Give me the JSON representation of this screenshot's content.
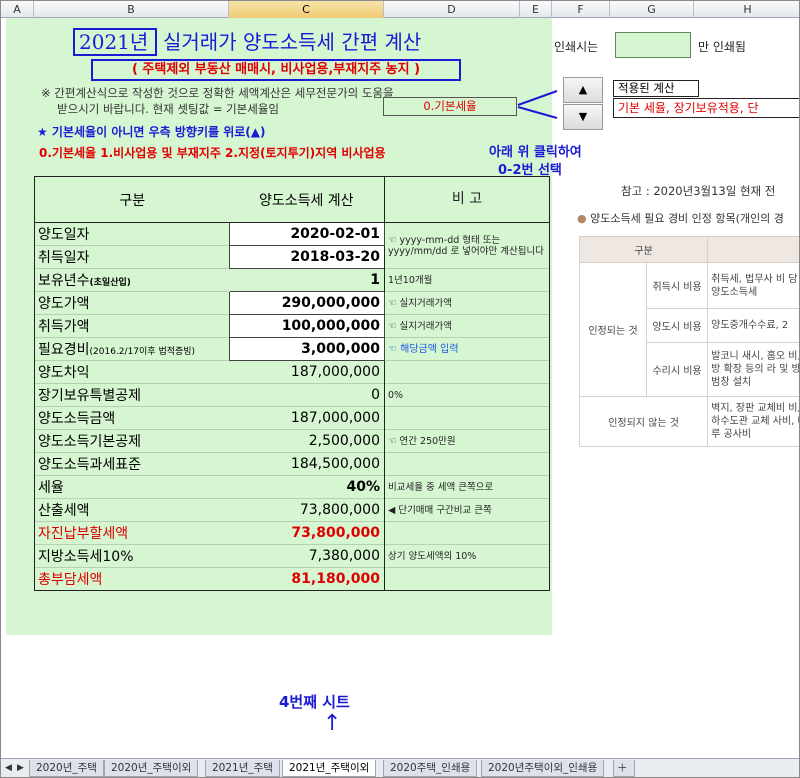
{
  "columns": [
    {
      "letter": "A"
    },
    {
      "letter": "B"
    },
    {
      "letter": "C"
    },
    {
      "letter": "D"
    },
    {
      "letter": "E"
    },
    {
      "letter": "F"
    },
    {
      "letter": "G"
    },
    {
      "letter": "H"
    }
  ],
  "title": {
    "year": "2021년",
    "rest": "실거래가 양도소득세 간편 계산",
    "subtitle": "( 주택제외 부동산 매매시, 비사업용,부재지주 농지 )"
  },
  "notes": {
    "line1": "※ 간편계산식으로 작성한 것으로 정확한 세액계산은 세무전문가의 도움을",
    "line2": "받으시기 바랍니다. 현재 셋팅값 = 기본세율임",
    "basic_box": "0.기본세율",
    "star": "★ 기본세율이 아니면 우측 방향키를 위로(▲)",
    "options": "0.기본세율  1.비사업용 및 부재지주  2.지정(토지투기)지역 비사업용"
  },
  "spin": {
    "up": "▲",
    "down": "▼"
  },
  "annotation": {
    "line1": "아래 위 클릭하여",
    "line2": "0-2번 선택"
  },
  "print": {
    "label": "인쇄시는",
    "suffix": "만 인쇄됨"
  },
  "applied": {
    "label": "적용된 계산",
    "value": "기본 세율, 장기보유적용, 단"
  },
  "table": {
    "header": {
      "col1": "구분",
      "col2": "양도소득세 계산",
      "col3": "비 고"
    },
    "rows": [
      {
        "label": "양도일자",
        "value": "2020-02-01",
        "note": "☜ yyyy-mm-dd 형태 또는 yyyy/mm/dd 로 넣어야만 계산됩니다"
      },
      {
        "label": "취득일자",
        "value": "2018-03-20",
        "note": ""
      },
      {
        "label": "보유년수",
        "label_sub": "(초일산입)",
        "value": "1",
        "note": "1년10개월"
      },
      {
        "label": "양도가액",
        "value": "290,000,000",
        "note": "☜ 실지거래가액"
      },
      {
        "label": "취득가액",
        "value": "100,000,000",
        "note": "☜ 실지거래가액"
      },
      {
        "label": "필요경비",
        "label_sub": "(2016.2/17이후 법적증빙)",
        "value": "3,000,000",
        "note": "☜ 해당금액 입력"
      },
      {
        "label": "양도차익",
        "value": "187,000,000",
        "note": ""
      },
      {
        "label": "장기보유특별공제",
        "value": "0",
        "note": "0%"
      },
      {
        "label": "양도소득금액",
        "value": "187,000,000",
        "note": ""
      },
      {
        "label": "양도소득기본공제",
        "value": "2,500,000",
        "note": "☜ 연간 250만원"
      },
      {
        "label": "양도소득과세표준",
        "value": "184,500,000",
        "note": ""
      },
      {
        "label": "세율",
        "value": "40%",
        "note": "비교세율 중 세액 큰쪽으로"
      },
      {
        "label": "산출세액",
        "value": "73,800,000",
        "note": "◀ 단기매매 구간비교 큰쪽"
      },
      {
        "label": "자진납부할세액",
        "value": "73,800,000",
        "note": ""
      },
      {
        "label": "지방소득세10%",
        "value": "7,380,000",
        "note": "상기 양도세액의 10%"
      },
      {
        "label": "총부담세액",
        "value": "81,180,000",
        "note": ""
      }
    ]
  },
  "reference": {
    "note": "참고 : 2020년3월13일 현재 전",
    "panel_title": "양도소득세 필요 경비 인정 항목(개인의 경",
    "col_header": "구분",
    "recognized": "인정되는 것",
    "not_recognized": "인정되지 않는 것",
    "items": [
      {
        "type": "취득시 비용",
        "desc": "취득세, 법무사 비 담 양도소득세"
      },
      {
        "type": "양도시 비용",
        "desc": "양도중개수수료, 2"
      },
      {
        "type": "수리시 비용",
        "desc": "발코니 새시, 홈오 비, 방 확장 등의 라 및 방범창 설치"
      }
    ],
    "not_desc": "벽지, 장판 교체비 비, 하수도관 교체 사비, 마루 공사비"
  },
  "fourth_sheet": "4번째 시트",
  "up_arrow": "↑",
  "tabs": [
    {
      "label": "2020년_주택"
    },
    {
      "label": "2020년_주택이외"
    },
    {
      "label": "2021년_주택"
    },
    {
      "label": "2021년_주택이외"
    },
    {
      "label": "2020주택_인쇄용"
    },
    {
      "label": "2020년주택이외_인쇄용"
    }
  ],
  "nav": {
    "first": "◀",
    "last": "▶"
  },
  "colors": {
    "accent_blue": "#1b1bd6",
    "red": "#e00000",
    "sheet_green": "#d6f5d1"
  }
}
